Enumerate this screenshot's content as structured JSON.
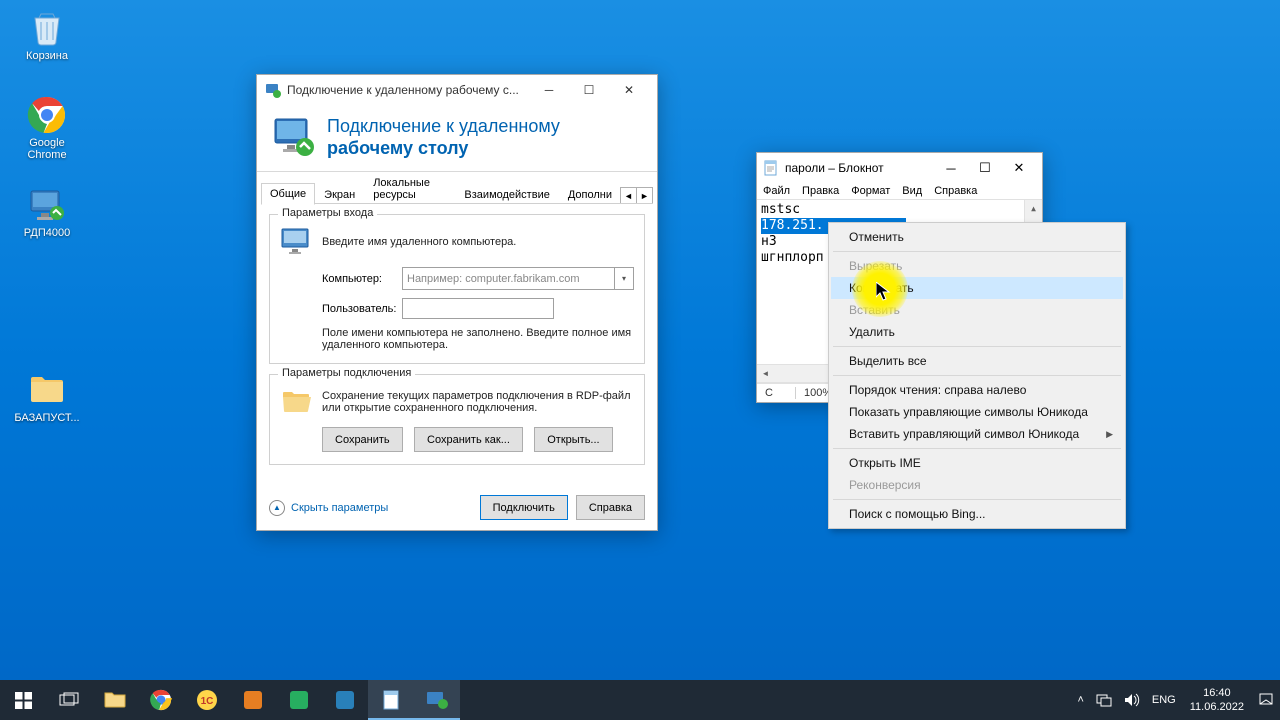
{
  "desktop": {
    "icons": {
      "recycle": "Корзина",
      "chrome": "Google Chrome",
      "rdp4000": "РДП4000",
      "folder1": "БАЗАПУСТ..."
    }
  },
  "rdp": {
    "title": "Подключение к удаленному рабочему с...",
    "header_line1": "Подключение к удаленному",
    "header_line2": "рабочему столу",
    "tabs": {
      "general": "Общие",
      "display": "Экран",
      "local": "Локальные ресурсы",
      "interaction": "Взаимодействие",
      "advanced": "Дополни"
    },
    "group_login_legend": "Параметры входа",
    "login_hint": "Введите имя удаленного компьютера.",
    "label_computer": "Компьютер:",
    "placeholder_computer": "Например: computer.fabrikam.com",
    "label_user": "Пользователь:",
    "login_warning": "Поле имени компьютера не заполнено. Введите полное имя удаленного компьютера.",
    "group_conn_legend": "Параметры подключения",
    "conn_hint": "Сохранение текущих параметров подключения в RDP-файл или открытие сохраненного подключения.",
    "btn_save": "Сохранить",
    "btn_saveas": "Сохранить как...",
    "btn_open": "Открыть...",
    "link_hide": "Скрыть параметры",
    "btn_connect": "Подключить",
    "btn_help": "Справка"
  },
  "notepad": {
    "title": "пароли – Блокнот",
    "menu": {
      "file": "Файл",
      "edit": "Правка",
      "format": "Формат",
      "view": "Вид",
      "help": "Справка"
    },
    "lines": {
      "l1": "mstsc",
      "l2": "178.251.",
      "l3": "н3",
      "l4": "шгнплорп"
    },
    "status_left": "С",
    "status_zoom": "100%"
  },
  "context_menu": {
    "undo": "Отменить",
    "cut": "Вырезать",
    "copy": "Копировать",
    "paste": "Вставить",
    "delete": "Удалить",
    "select_all": "Выделить все",
    "rtl": "Порядок чтения: справа налево",
    "show_unicode": "Показать управляющие символы Юникода",
    "insert_unicode": "Вставить управляющий символ Юникода",
    "open_ime": "Открыть IME",
    "reconvert": "Реконверсия",
    "bing": "Поиск с помощью Bing..."
  },
  "taskbar": {
    "lang": "ENG",
    "time": "16:40",
    "date": "11.06.2022"
  }
}
